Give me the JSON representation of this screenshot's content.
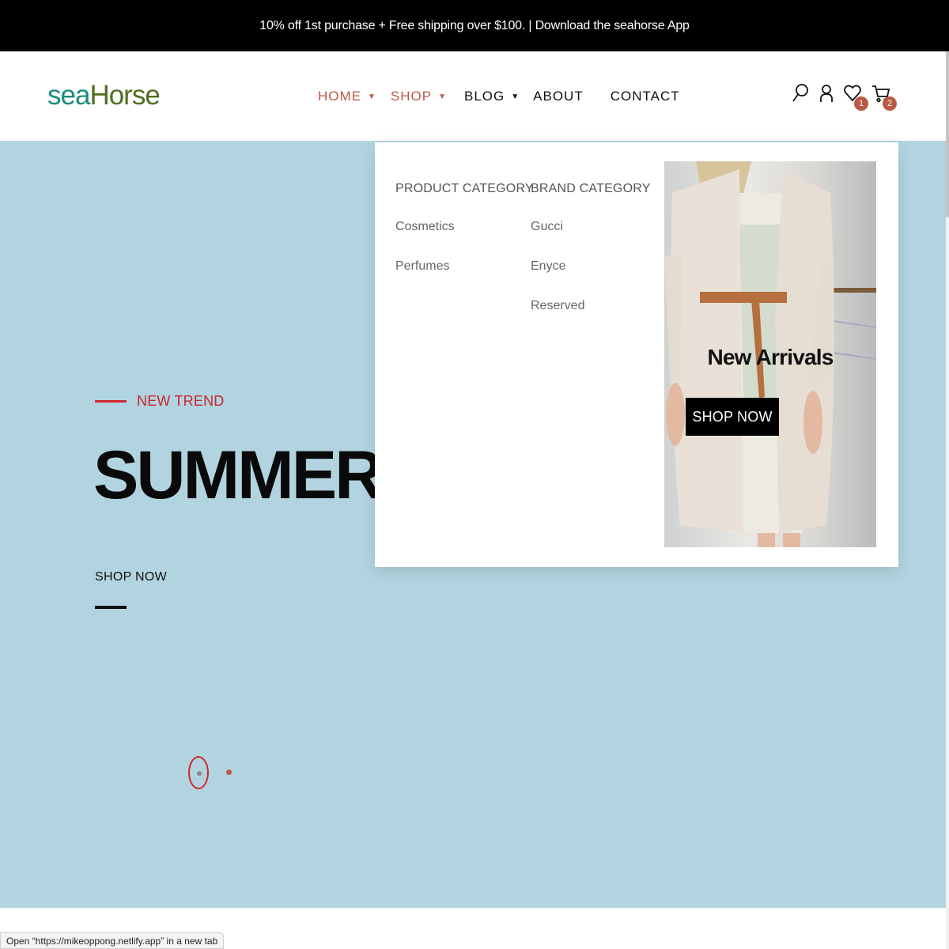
{
  "announcement": "10% off 1st purchase + Free shipping over $100. | Download the seahorse App",
  "logo": {
    "part1": "sea",
    "part2": "Horse"
  },
  "nav": {
    "items": [
      {
        "label": "HOME",
        "has_dropdown": true,
        "active": true
      },
      {
        "label": "SHOP",
        "has_dropdown": true,
        "active": true
      },
      {
        "label": "BLOG",
        "has_dropdown": true,
        "active": false
      },
      {
        "label": "ABOUT",
        "has_dropdown": false,
        "active": false
      },
      {
        "label": "CONTACT",
        "has_dropdown": false,
        "active": false
      }
    ],
    "caret_icon": "caret-down-icon"
  },
  "header_icons": {
    "search": "search-icon",
    "account": "user-icon",
    "wishlist": {
      "icon": "heart-icon",
      "count": "1"
    },
    "cart": {
      "icon": "cart-icon",
      "count": "2"
    }
  },
  "hero": {
    "eyebrow": "NEW TREND",
    "title": "SUMMER SALE",
    "cta": "SHOP NOW"
  },
  "mega_menu": {
    "product_category": {
      "title": "PRODUCT CATEGORY",
      "links": [
        "Cosmetics",
        "Perfumes"
      ]
    },
    "brand_category": {
      "title": "BRAND CATEGORY",
      "links": [
        "Gucci",
        "Enyce",
        "Reserved"
      ]
    },
    "promo": {
      "title": "New Arrivals",
      "button": "SHOP NOW"
    }
  },
  "status_bar": "Open “https://mikeoppong.netlify.app” in a new tab",
  "colors": {
    "accent": "#b85a44",
    "trend_red": "#c8252b",
    "hero_bg": "#b2d4e0",
    "logo_sea": "#1c8a7c",
    "logo_horse": "#4f6f1f"
  }
}
